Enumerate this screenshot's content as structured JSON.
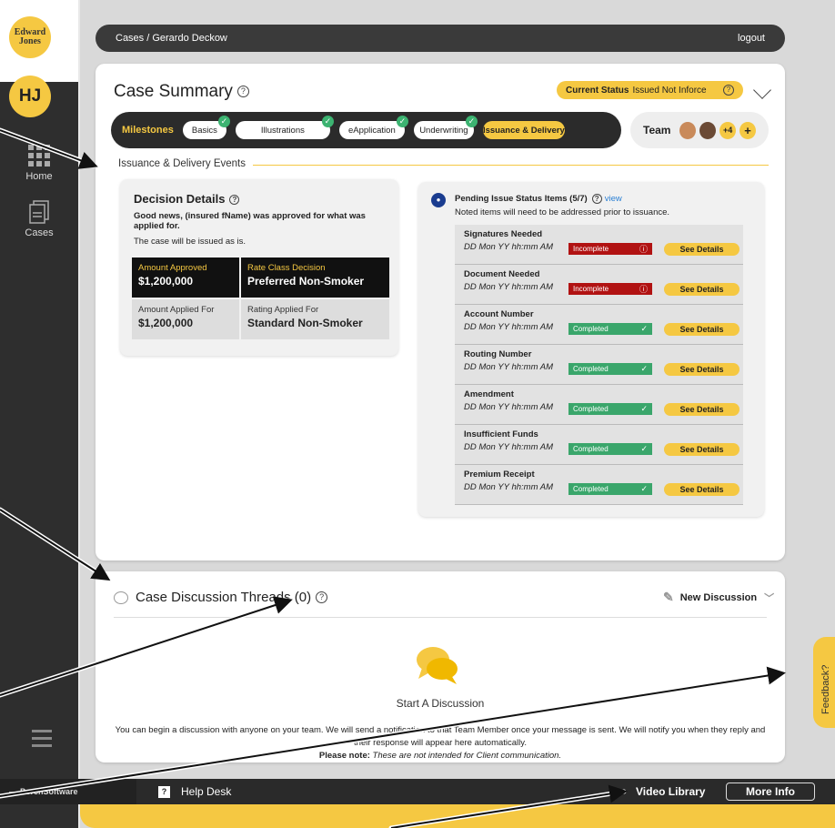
{
  "logo": {
    "line1": "Edward",
    "line2": "Jones"
  },
  "user": {
    "initials": "HJ"
  },
  "sidebar": {
    "items": [
      {
        "label": "Home",
        "icon": "grid-icon"
      },
      {
        "label": "Cases",
        "icon": "document-icon"
      }
    ]
  },
  "topbar": {
    "breadcrumb": "Cases / Gerardo Deckow",
    "logout": "logout"
  },
  "summary": {
    "title": "Case Summary",
    "status_label": "Current Status",
    "status_value": "Issued Not Inforce",
    "milestones_label": "Milestones",
    "milestones": [
      {
        "label": "Basics",
        "done": true
      },
      {
        "label": "Illustrations",
        "done": true
      },
      {
        "label": "eApplication",
        "done": true
      },
      {
        "label": "Underwriting",
        "done": true
      },
      {
        "label": "Issuance & Delivery",
        "done": false
      }
    ],
    "team_label": "Team",
    "team_more": "+4",
    "team_add": "+",
    "section_title": "Issuance & Delivery Events"
  },
  "decision": {
    "title": "Decision Details",
    "message": "Good news, (insured fName) was approved for what was applied for.",
    "note": "The case will be issued as is.",
    "cells": [
      {
        "label": "Amount Approved",
        "value": "$1,200,000"
      },
      {
        "label": "Rate Class Decision",
        "value": "Preferred Non-Smoker"
      },
      {
        "label": "Amount Applied For",
        "value": "$1,200,000"
      },
      {
        "label": "Rating Applied For",
        "value": "Standard Non-Smoker"
      }
    ]
  },
  "pending": {
    "title": "Pending Issue Status Items (5/7)",
    "view": "view",
    "subtitle": "Noted items will need to be addressed prior to issuance.",
    "see_label": "See Details",
    "items": [
      {
        "name": "Signatures Needed",
        "date": "DD Mon YY hh:mm AM",
        "status": "Incomplete",
        "mark": "ⓘ"
      },
      {
        "name": "Document Needed",
        "date": "DD Mon YY hh:mm AM",
        "status": "Incomplete",
        "mark": "ⓘ"
      },
      {
        "name": "Account Number",
        "date": "DD Mon YY hh:mm AM",
        "status": "Completed",
        "mark": "✓"
      },
      {
        "name": "Routing Number",
        "date": "DD Mon YY hh:mm AM",
        "status": "Completed",
        "mark": "✓"
      },
      {
        "name": "Amendment",
        "date": "DD Mon YY hh:mm AM",
        "status": "Completed",
        "mark": "✓"
      },
      {
        "name": "Insufficient Funds",
        "date": "DD Mon YY hh:mm AM",
        "status": "Completed",
        "mark": "✓"
      },
      {
        "name": "Premium Receipt",
        "date": "DD Mon YY hh:mm AM",
        "status": "Completed",
        "mark": "✓"
      }
    ]
  },
  "discussion": {
    "title": "Case Discussion Threads (0)",
    "new_label": "New Discussion",
    "start": "Start A Discussion",
    "desc": "You can begin a discussion with anyone on your team. We will send a notification to that Team Member once your message is sent. We will notify you when they reply and their response will appear here automatically.",
    "note_label": "Please note:",
    "note_text": "These are not intended for Client communication."
  },
  "feedback": "Feedback?",
  "bottom": {
    "brand": "PorchSoftware",
    "help": "Help Desk",
    "video": "Video Library",
    "more": "More Info"
  },
  "colors": {
    "accent": "#f5c842",
    "dark": "#2e2e2e",
    "incomplete": "#b11212",
    "completed": "#3aa66b"
  }
}
